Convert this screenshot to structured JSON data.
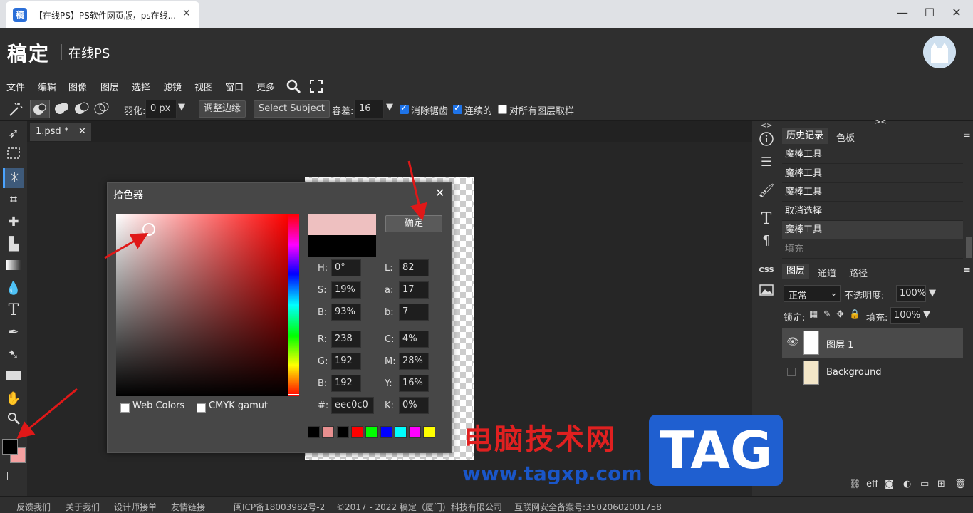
{
  "browser": {
    "tab_title": "【在线PS】PS软件网页版，ps在线...",
    "favicon_text": "稿",
    "close": "✕",
    "win_min": "—",
    "win_max": "☐",
    "win_close": "✕"
  },
  "header": {
    "logo": "稿定",
    "subtitle": "在线PS"
  },
  "menu": [
    "文件",
    "编辑",
    "图像",
    "图层",
    "选择",
    "滤镜",
    "视图",
    "窗口",
    "更多"
  ],
  "options": {
    "feather_label": "羽化:",
    "feather_value": "0 px",
    "refine_edge": "调整边缘",
    "select_subject": "Select Subject",
    "tolerance_label": "容差:",
    "tolerance_value": "16",
    "antialias_label": "消除锯齿",
    "contiguous_label": "连续的",
    "sample_all_label": "对所有图层取样",
    "antialias_checked": true,
    "contiguous_checked": true,
    "sample_all_checked": false
  },
  "document": {
    "tab_label": "1.psd *",
    "tab_close": "✕"
  },
  "color_picker": {
    "title": "拾色器",
    "close": "✕",
    "ok_button": "确定",
    "fields": {
      "H": "0°",
      "S": "19%",
      "Bv": "93%",
      "L": "82",
      "a": "17",
      "b": "7",
      "R": "238",
      "G": "192",
      "B": "192",
      "C": "4%",
      "M": "28%",
      "Y": "16%",
      "hex": "eec0c0",
      "K": "0%"
    },
    "labels": {
      "H": "H:",
      "S": "S:",
      "Bv": "B:",
      "L": "L:",
      "a": "a:",
      "b": "b:",
      "R": "R:",
      "G": "G:",
      "B": "B:",
      "C": "C:",
      "M": "M:",
      "Y": "Y:",
      "hex": "#:",
      "K": "K:"
    },
    "web_colors": "Web Colors",
    "cmyk_gamut": "CMYK gamut",
    "new_color": "#eec0c0",
    "old_color": "#000000",
    "palette": [
      "#000000",
      "#e88f8f",
      "#000000",
      "#ff0000",
      "#00ff00",
      "#0000ff",
      "#00ffff",
      "#ff00ff",
      "#ffff00"
    ]
  },
  "history_panel": {
    "tabs": [
      "历史记录",
      "色板"
    ],
    "items": [
      "魔棒工具",
      "魔棒工具",
      "魔棒工具",
      "取消选择",
      "魔棒工具",
      "填充"
    ]
  },
  "layers_panel": {
    "tabs": [
      "图层",
      "通道",
      "路径"
    ],
    "blend_mode": "正常",
    "opacity_label": "不透明度:",
    "opacity_value": "100%",
    "lock_label": "锁定:",
    "fill_label": "填充:",
    "fill_value": "100%",
    "layers": [
      {
        "name": "图层 1",
        "visible": true,
        "selected": true
      },
      {
        "name": "Background",
        "visible": false,
        "selected": false
      }
    ]
  },
  "tool_colors": {
    "foreground": "#000000",
    "background": "#f4a0a0"
  },
  "footer": {
    "links": [
      "反馈我们",
      "关于我们",
      "设计师接单",
      "友情链接"
    ],
    "icp": "闽ICP备18003982号-2",
    "copyright": "©2017 - 2022 稿定（厦门）科技有限公司",
    "security": "互联网安全备案号:35020602001758"
  },
  "watermark": {
    "title": "电脑技术网",
    "tag": "TAG",
    "url": "www.tagxp.com"
  },
  "colors": {
    "accent": "#1e73e8",
    "panel": "#2f2f2f",
    "canvas": "#262626"
  }
}
